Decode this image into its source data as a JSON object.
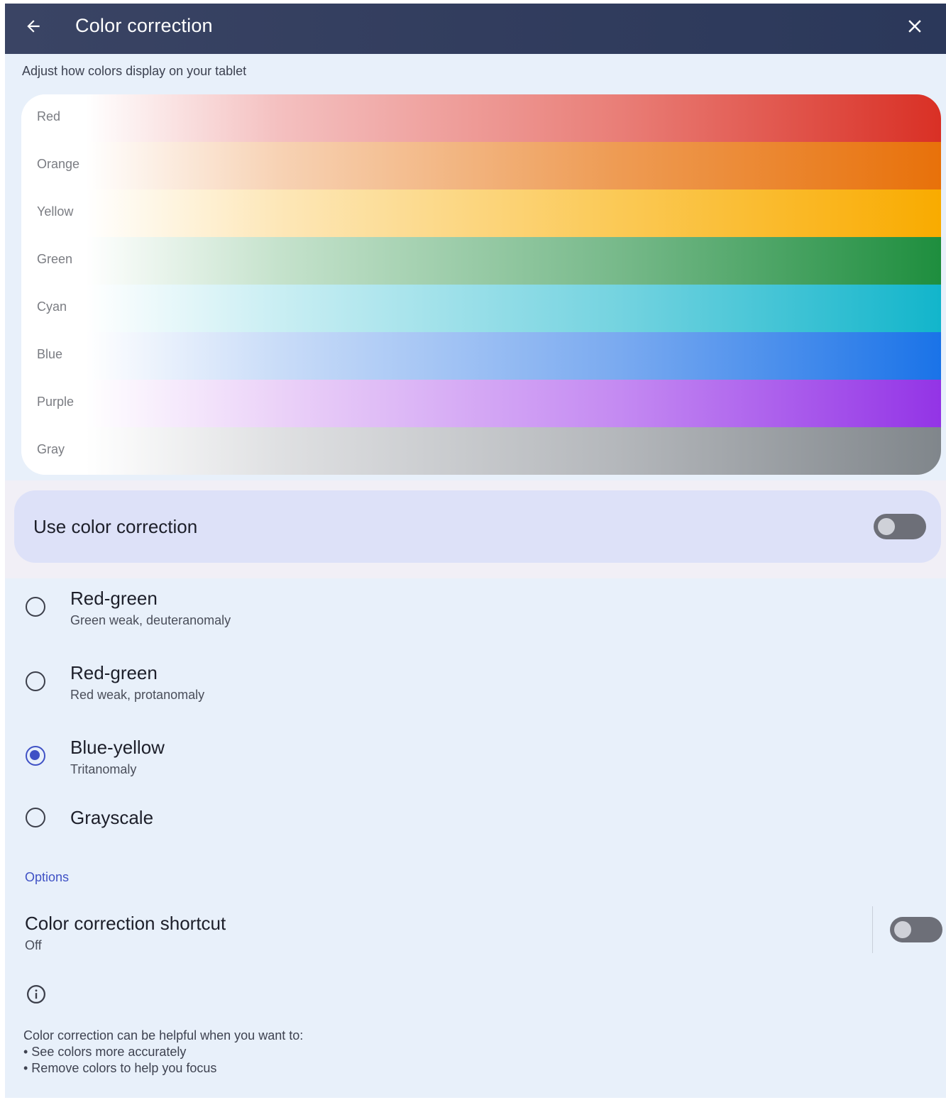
{
  "header": {
    "title": "Color correction",
    "back_icon": "arrow-left-icon",
    "close_icon": "close-icon"
  },
  "subtitle": "Adjust how colors display on your tablet",
  "palette": {
    "bands": [
      {
        "label": "Red",
        "color": "#d93025"
      },
      {
        "label": "Orange",
        "color": "#e8710a"
      },
      {
        "label": "Yellow",
        "color": "#f9ab00"
      },
      {
        "label": "Green",
        "color": "#1e8e3e"
      },
      {
        "label": "Cyan",
        "color": "#12b5cb"
      },
      {
        "label": "Blue",
        "color": "#1a73e8"
      },
      {
        "label": "Purple",
        "color": "#9334e6"
      },
      {
        "label": "Gray",
        "color": "#80868b"
      }
    ]
  },
  "main_toggle": {
    "label": "Use color correction",
    "state": "off"
  },
  "modes": [
    {
      "title": "Red-green",
      "subtitle": "Green weak, deuteranomaly",
      "selected": false
    },
    {
      "title": "Red-green",
      "subtitle": "Red weak, protanomaly",
      "selected": false
    },
    {
      "title": "Blue-yellow",
      "subtitle": "Tritanomaly",
      "selected": true
    },
    {
      "title": "Grayscale",
      "subtitle": "",
      "selected": false
    }
  ],
  "options": {
    "section_label": "Options",
    "shortcut_title": "Color correction shortcut",
    "shortcut_status": "Off"
  },
  "info": {
    "icon": "info-icon",
    "intro": "Color correction can be helpful when you want to:",
    "bullet_1": "• See colors more accurately",
    "bullet_2": "• Remove colors to help you focus"
  },
  "colors": {
    "header_bg": "#323d5e",
    "page_bg": "#e8f0fa",
    "accent": "#3f51c5",
    "toggle_card_bg": "#dde1f8"
  }
}
